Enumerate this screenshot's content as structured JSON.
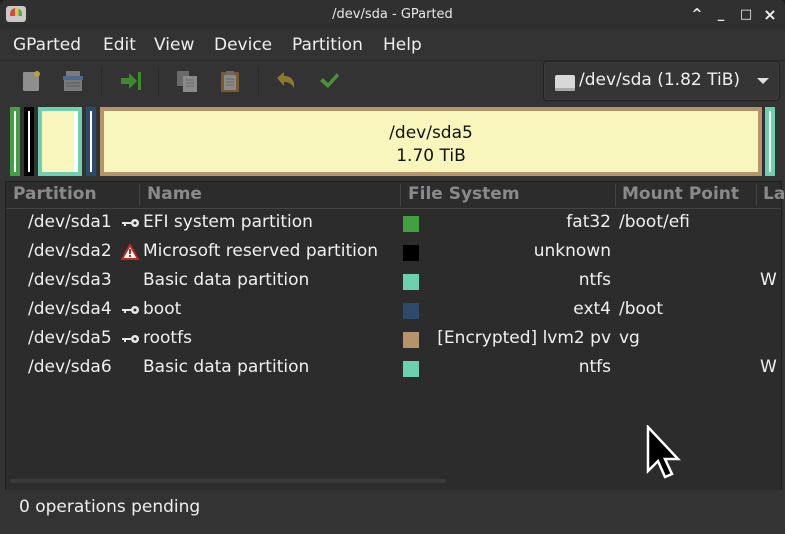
{
  "window": {
    "title": "/dev/sda - GParted",
    "controls": [
      "^",
      "_",
      "□",
      "×"
    ]
  },
  "menu": [
    "GParted",
    "Edit",
    "View",
    "Device",
    "Partition",
    "Help"
  ],
  "toolbar": {
    "buttons": [
      {
        "name": "new-partition",
        "icon": "new-icon"
      },
      {
        "name": "delete-partition",
        "icon": "delete-icon"
      },
      {
        "name": "resize-move",
        "icon": "resize-move-icon"
      },
      {
        "name": "copy",
        "icon": "copy-icon"
      },
      {
        "name": "paste",
        "icon": "paste-icon"
      },
      {
        "name": "undo",
        "icon": "undo-icon"
      },
      {
        "name": "apply",
        "icon": "apply-icon"
      }
    ]
  },
  "device_selector": {
    "label": "/dev/sda (1.82 TiB)"
  },
  "diskmap": {
    "selected_label": "/dev/sda5",
    "selected_size": "1.70 TiB"
  },
  "table": {
    "columns": [
      "Partition",
      "Name",
      "File System",
      "Mount Point",
      "La"
    ],
    "rows": [
      {
        "partition": "/dev/sda1",
        "flag": "key",
        "name": "EFI system partition",
        "color": "#43a040",
        "fs": "fat32",
        "mount": "/boot/efi",
        "label": ""
      },
      {
        "partition": "/dev/sda2",
        "flag": "warning",
        "name": "Microsoft reserved partition",
        "color": "#000000",
        "fs": "unknown",
        "mount": "",
        "label": ""
      },
      {
        "partition": "/dev/sda3",
        "flag": "",
        "name": "Basic data partition",
        "color": "#6dd1b0",
        "fs": "ntfs",
        "mount": "",
        "label": "W"
      },
      {
        "partition": "/dev/sda4",
        "flag": "key",
        "name": "boot",
        "color": "#2e4a6a",
        "fs": "ext4",
        "mount": "/boot",
        "label": ""
      },
      {
        "partition": "/dev/sda5",
        "flag": "key",
        "name": "rootfs",
        "color": "#b5936b",
        "fs": "[Encrypted] lvm2 pv",
        "mount": "vg",
        "label": ""
      },
      {
        "partition": "/dev/sda6",
        "flag": "",
        "name": "Basic data partition",
        "color": "#6dd1b0",
        "fs": "ntfs",
        "mount": "",
        "label": "W"
      }
    ]
  },
  "status": {
    "text": "0 operations pending"
  },
  "colors": {
    "fat32": "#43a040",
    "unknown": "#000000",
    "ntfs": "#6dd1b0",
    "ext4": "#2e4a6a",
    "lvm2": "#b5936b",
    "used": "#f8f6bc"
  }
}
